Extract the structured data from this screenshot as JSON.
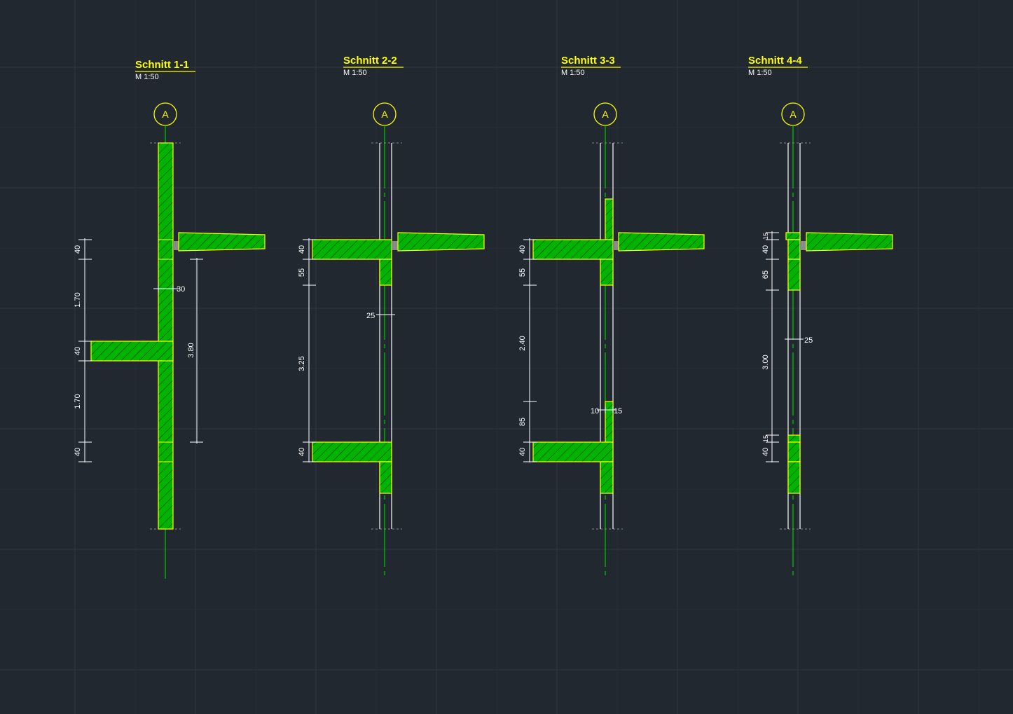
{
  "colors": {
    "background": "#212830",
    "grid": "#2d3640",
    "concrete_fill": "#00b400",
    "concrete_outline": "#ffff00",
    "axis_line": "#00c800",
    "dimension_line": "#ffffff",
    "bearing": "#8a8a8a"
  },
  "sections": [
    {
      "title": "Schnitt 1-1",
      "scale": "M 1:50",
      "axis": "A",
      "dims_left": [
        "40",
        "1.70",
        "40",
        "1.70",
        "40"
      ],
      "dims_right": [
        "3.80"
      ],
      "dims_thickness": [
        "30"
      ]
    },
    {
      "title": "Schnitt 2-2",
      "scale": "M 1:50",
      "axis": "A",
      "dims_left": [
        "40",
        "55",
        "3.25",
        "40"
      ],
      "dims_thickness": [
        "25"
      ]
    },
    {
      "title": "Schnitt 3-3",
      "scale": "M 1:50",
      "axis": "A",
      "dims_left": [
        "40",
        "55",
        "2.40",
        "85",
        "40"
      ],
      "dims_thickness": [
        "10",
        "15"
      ]
    },
    {
      "title": "Schnitt 4-4",
      "scale": "M 1:50",
      "axis": "A",
      "dims_left": [
        "15",
        "40",
        "65",
        "3.00",
        "15",
        "40"
      ],
      "dims_thickness": [
        "25"
      ]
    }
  ]
}
